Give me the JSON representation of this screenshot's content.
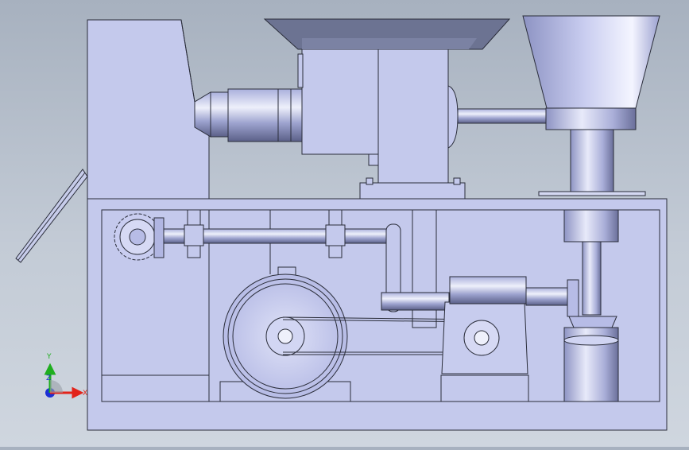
{
  "triad": {
    "x_label": "X",
    "y_label": "Y",
    "z_label": "Z",
    "x_color": "#e2231a",
    "y_color": "#1fae1f",
    "z_color": "#1c2fd6"
  },
  "colors": {
    "part_fill": "#c4c9ec",
    "part_stroke": "#2a2d3a",
    "hopper_dark": "#6c7392",
    "background": "#b9c2ce"
  }
}
